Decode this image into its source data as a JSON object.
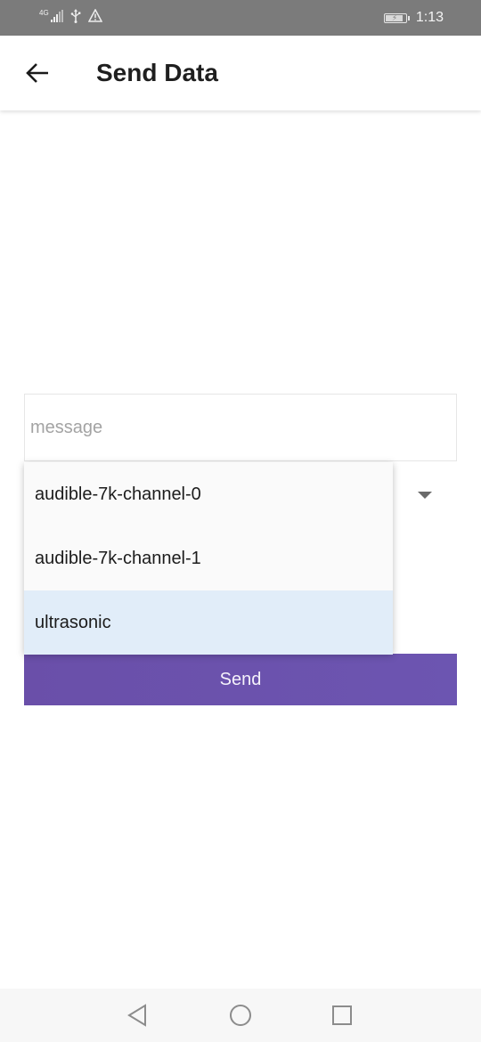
{
  "status_bar": {
    "network_type": "4G",
    "time": "1:13",
    "icons": [
      "signal-icon",
      "usb-icon",
      "warning-icon",
      "battery-charging-icon"
    ]
  },
  "app_bar": {
    "title": "Send Data",
    "back_icon": "arrow-back-icon"
  },
  "form": {
    "message_placeholder": "message",
    "message_value": "",
    "send_label": "Send"
  },
  "dropdown": {
    "options": [
      "audible-7k-channel-0",
      "audible-7k-channel-1",
      "ultrasonic"
    ],
    "selected": "ultrasonic"
  },
  "nav_bar": {
    "buttons": [
      "back-triangle-icon",
      "home-circle-icon",
      "recents-square-icon"
    ]
  },
  "colors": {
    "status_bar": "#7b7b7b",
    "send_button": "#6b52ad",
    "selected_option": "#e1edf9"
  }
}
